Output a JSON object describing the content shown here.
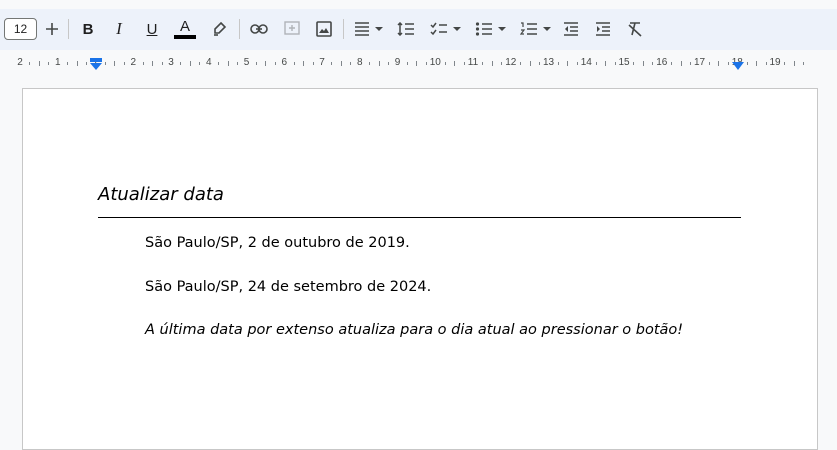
{
  "toolbar": {
    "font_size": "12",
    "bold_label": "B",
    "italic_label": "I",
    "underline_label": "U",
    "text_color_label": "A",
    "text_color": "#000000"
  },
  "ruler": {
    "labels": [
      "2",
      "1",
      "1",
      "2",
      "3",
      "4",
      "5",
      "6",
      "7",
      "8",
      "9",
      "10",
      "11",
      "12",
      "13",
      "14",
      "15",
      "16",
      "17",
      "18",
      "19"
    ]
  },
  "document": {
    "title": "Atualizar data",
    "paragraphs": [
      "São Paulo/SP, 2 de outubro de 2019.",
      "São Paulo/SP, 24 de setembro de 2024.",
      "A última data por extenso atualiza para o dia atual ao pressionar o botão!"
    ]
  },
  "colors": {
    "toolbar_bg": "#edf2fa",
    "indent_marker": "#1a73e8",
    "icon": "#444746"
  }
}
